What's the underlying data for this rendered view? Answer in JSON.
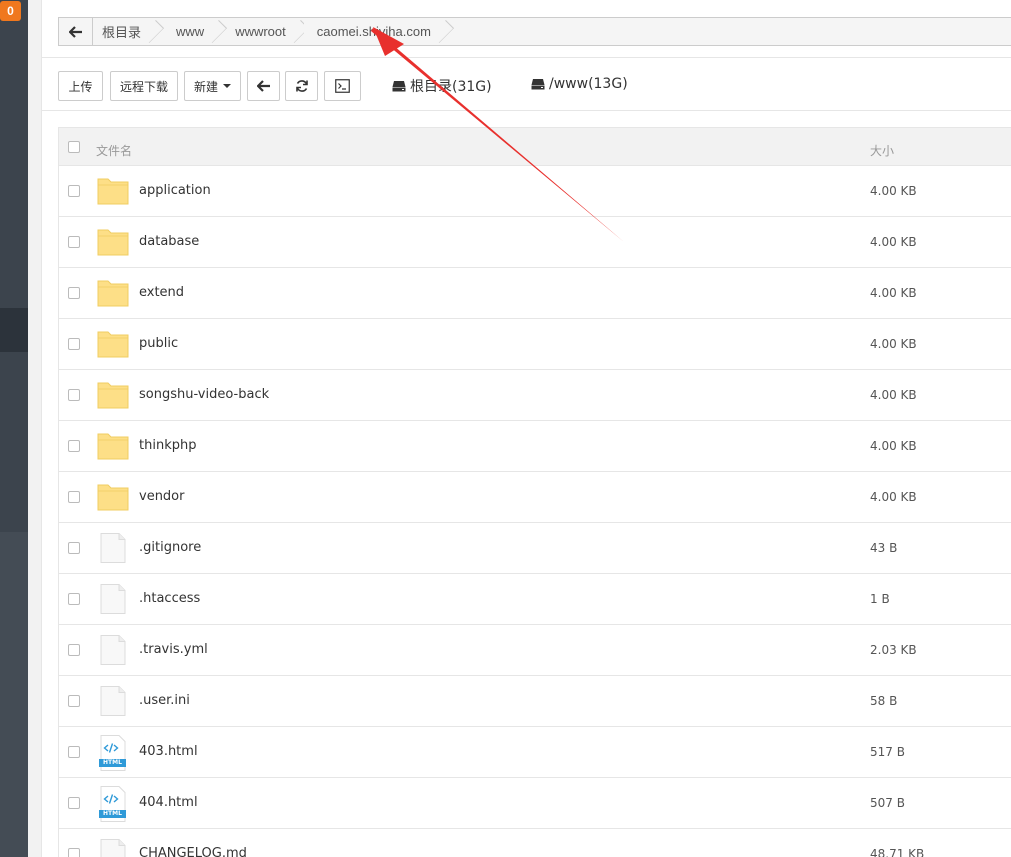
{
  "sidebar": {
    "badge": "0"
  },
  "breadcrumb": {
    "items": [
      {
        "label": "根目录"
      },
      {
        "label": "www"
      },
      {
        "label": "wwwroot"
      },
      {
        "label": "caomei.shiyiha.com"
      }
    ]
  },
  "toolbar": {
    "upload": "上传",
    "remote_download": "远程下载",
    "new": "新建",
    "disks": [
      {
        "label": "根目录(31G)"
      },
      {
        "label": "/www(13G)"
      }
    ]
  },
  "table": {
    "headers": {
      "name": "文件名",
      "size": "大小"
    },
    "rows": [
      {
        "icon": "folder-icon",
        "name": "application",
        "size": "4.00 KB"
      },
      {
        "icon": "folder-icon",
        "name": "database",
        "size": "4.00 KB"
      },
      {
        "icon": "folder-icon",
        "name": "extend",
        "size": "4.00 KB"
      },
      {
        "icon": "folder-icon",
        "name": "public",
        "size": "4.00 KB"
      },
      {
        "icon": "folder-icon",
        "name": "songshu-video-back",
        "size": "4.00 KB"
      },
      {
        "icon": "folder-icon",
        "name": "thinkphp",
        "size": "4.00 KB"
      },
      {
        "icon": "folder-icon",
        "name": "vendor",
        "size": "4.00 KB"
      },
      {
        "icon": "file-icon",
        "name": ".gitignore",
        "size": "43 B"
      },
      {
        "icon": "file-icon",
        "name": ".htaccess",
        "size": "1 B"
      },
      {
        "icon": "file-icon",
        "name": ".travis.yml",
        "size": "2.03 KB"
      },
      {
        "icon": "file-icon",
        "name": ".user.ini",
        "size": "58 B"
      },
      {
        "icon": "html-file-icon",
        "name": "403.html",
        "size": "517 B",
        "badge": "HTML"
      },
      {
        "icon": "html-file-icon",
        "name": "404.html",
        "size": "507 B",
        "badge": "HTML"
      },
      {
        "icon": "file-icon",
        "name": "CHANGELOG.md",
        "size": "48.71 KB"
      }
    ]
  },
  "colors": {
    "folder": "#fddf87",
    "html_badge": "#2f9ad8",
    "annotation_arrow": "#e8302d",
    "sidebar": "#3c444d",
    "badge": "#f0781e"
  }
}
